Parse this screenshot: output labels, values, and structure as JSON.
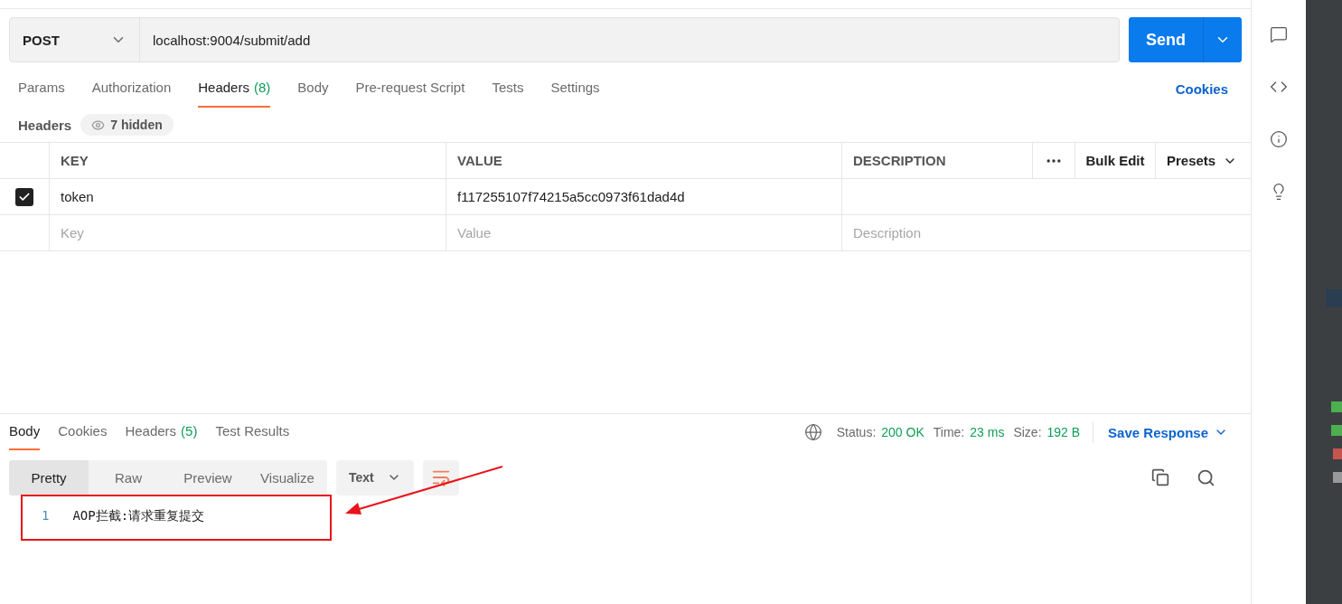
{
  "request": {
    "method": "POST",
    "url": "localhost:9004/submit/add",
    "send": "Send"
  },
  "request_tabs": [
    {
      "label": "Params",
      "selected": false
    },
    {
      "label": "Authorization",
      "selected": false
    },
    {
      "label": "Headers",
      "count": "(8)",
      "selected": true
    },
    {
      "label": "Body",
      "selected": false
    },
    {
      "label": "Pre-request Script",
      "selected": false
    },
    {
      "label": "Tests",
      "selected": false
    },
    {
      "label": "Settings",
      "selected": false
    }
  ],
  "cookies_link": "Cookies",
  "headers_bar": {
    "label": "Headers",
    "hidden": "7 hidden"
  },
  "headers_table": {
    "columns": [
      "KEY",
      "VALUE",
      "DESCRIPTION"
    ],
    "bulk_edit": "Bulk Edit",
    "presets": "Presets",
    "rows": [
      {
        "checked": true,
        "key": "token",
        "value": "f117255107f74215a5cc0973f61dad4d"
      }
    ],
    "new_row": {
      "key_placeholder": "Key",
      "value_placeholder": "Value",
      "description_placeholder": "Description"
    }
  },
  "response_tabs": [
    {
      "label": "Body",
      "selected": true
    },
    {
      "label": "Cookies",
      "selected": false
    },
    {
      "label": "Headers",
      "count": "(5)",
      "selected": false
    },
    {
      "label": "Test Results",
      "selected": false
    }
  ],
  "response_meta": [
    {
      "label": "Status:",
      "value": "200 OK"
    },
    {
      "label": "Time:",
      "value": "23 ms"
    },
    {
      "label": "Size:",
      "value": "192 B"
    }
  ],
  "save_response": "Save Response",
  "view_modes": [
    {
      "label": "Pretty",
      "selected": true
    },
    {
      "label": "Raw",
      "selected": false
    },
    {
      "label": "Preview",
      "selected": false
    },
    {
      "label": "Visualize",
      "selected": false
    }
  ],
  "format": "Text",
  "code_lines": [
    {
      "number": "1",
      "text": "AOP拦截:请求重复提交"
    }
  ]
}
